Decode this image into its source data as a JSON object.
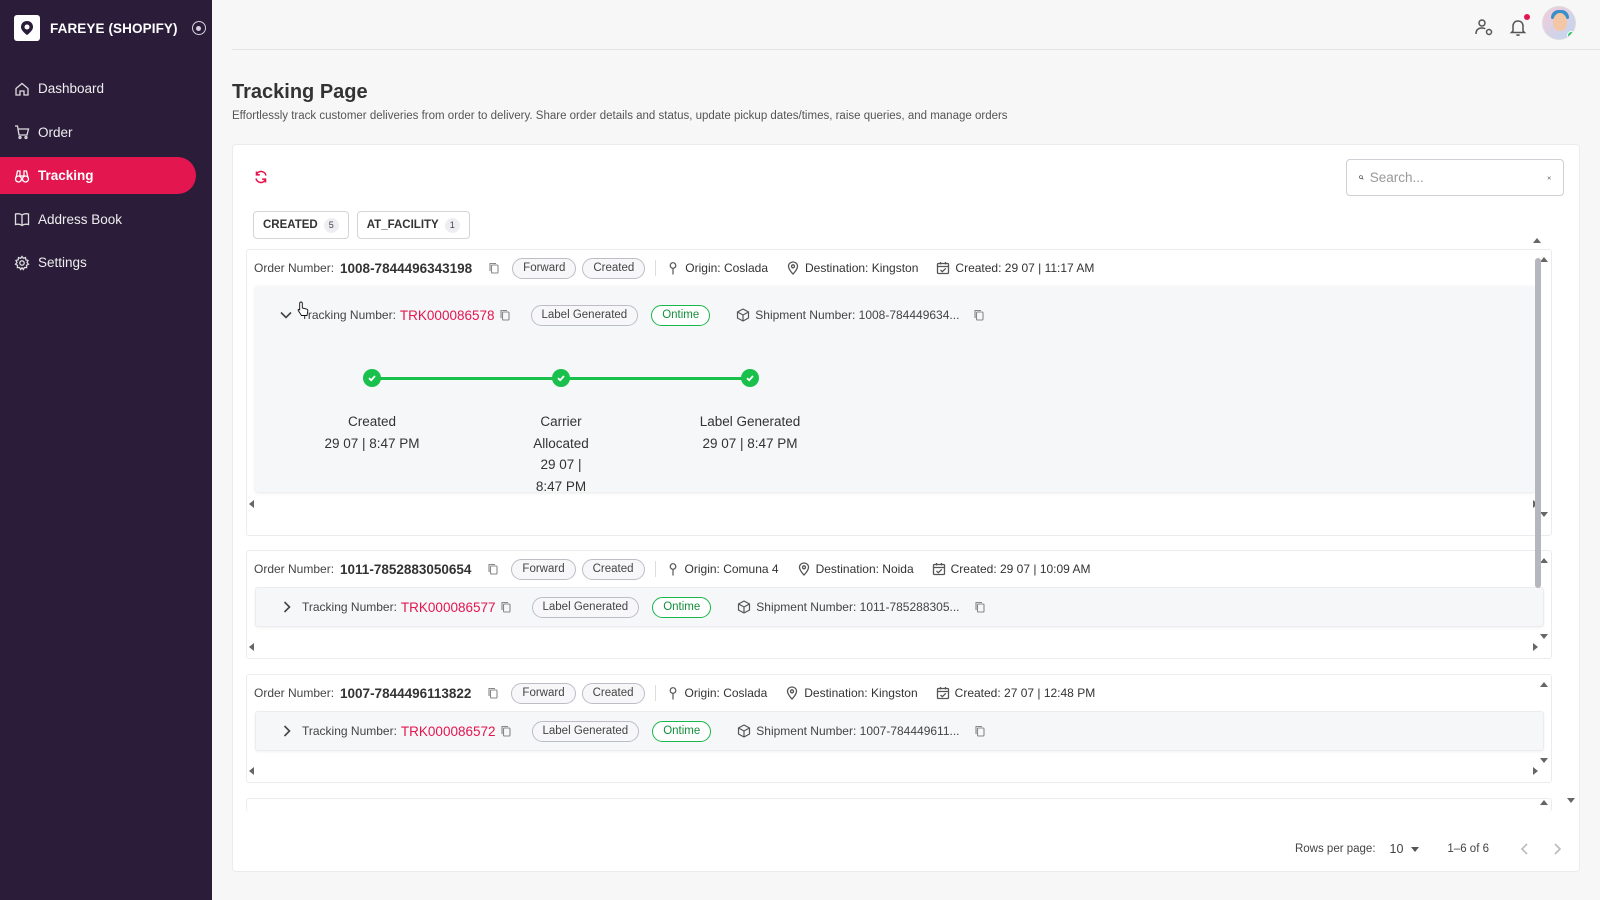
{
  "sidebar": {
    "brand": "FAREYE (SHOPIFY)",
    "items": [
      {
        "label": "Dashboard",
        "icon": "home-icon"
      },
      {
        "label": "Order",
        "icon": "cart-icon"
      },
      {
        "label": "Tracking",
        "icon": "binoculars-icon",
        "active": true
      },
      {
        "label": "Address Book",
        "icon": "book-icon"
      },
      {
        "label": "Settings",
        "icon": "gear-icon"
      }
    ]
  },
  "page": {
    "title": "Tracking Page",
    "subtitle": "Effortlessly track customer deliveries from order to delivery. Share order details and status, update pickup dates/times, raise queries, and manage orders"
  },
  "search": {
    "placeholder": "Search..."
  },
  "filters": [
    {
      "label": "CREATED",
      "count": "5"
    },
    {
      "label": "AT_FACILITY",
      "count": "1"
    }
  ],
  "labels": {
    "order_number": "Order Number:",
    "tracking_number": "Tracking Number:"
  },
  "orders": [
    {
      "number": "1008-7844496343198",
      "direction": "Forward",
      "status": "Created",
      "origin": "Origin: Coslada",
      "destination": "Destination: Kingston",
      "created": "Created: 29 07 | 11:17 AM",
      "tracking": "TRK000086578",
      "label_status": "Label Generated",
      "timeliness": "Ontime",
      "shipment": "Shipment Number: 1008-784449634...",
      "expanded": true,
      "timeline": [
        {
          "title": "Created",
          "time": "29 07 | 8:47 PM"
        },
        {
          "title": "Carrier Allocated",
          "time": "29 07 | 8:47 PM"
        },
        {
          "title": "Label Generated",
          "time": "29 07 | 8:47 PM"
        }
      ]
    },
    {
      "number": "1011-7852883050654",
      "direction": "Forward",
      "status": "Created",
      "origin": "Origin: Comuna 4",
      "destination": "Destination: Noida",
      "created": "Created: 29 07 | 10:09 AM",
      "tracking": "TRK000086577",
      "label_status": "Label Generated",
      "timeliness": "Ontime",
      "shipment": "Shipment Number: 1011-785288305..."
    },
    {
      "number": "1007-7844496113822",
      "direction": "Forward",
      "status": "Created",
      "origin": "Origin: Coslada",
      "destination": "Destination: Kingston",
      "created": "Created: 27 07 | 12:48 PM",
      "tracking": "TRK000086572",
      "label_status": "Label Generated",
      "timeliness": "Ontime",
      "shipment": "Shipment Number: 1007-784449611..."
    }
  ],
  "footer": {
    "rows_per_page_label": "Rows per page:",
    "rows_per_page": "10",
    "range": "1–6 of 6"
  },
  "colors": {
    "accent": "#e3164f",
    "sidebar": "#2b1d3a",
    "success": "#19c04b"
  }
}
